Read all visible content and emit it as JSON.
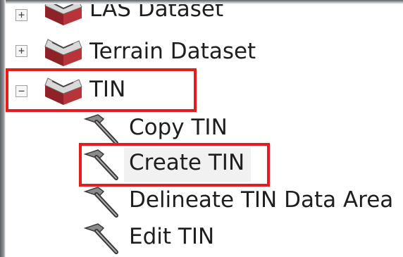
{
  "tree": {
    "toolsets": [
      {
        "label": "LAS Dataset",
        "expander": "+",
        "icon": "toolbox-icon"
      },
      {
        "label": "Terrain Dataset",
        "expander": "+",
        "icon": "toolbox-icon"
      },
      {
        "label": "TIN",
        "expander": "−",
        "icon": "toolbox-icon"
      }
    ],
    "tools": [
      {
        "label": "Copy TIN",
        "icon": "hammer-icon"
      },
      {
        "label": "Create TIN",
        "icon": "hammer-icon"
      },
      {
        "label": "Delineate TIN Data Area",
        "icon": "hammer-icon"
      },
      {
        "label": "Edit TIN",
        "icon": "hammer-icon"
      }
    ]
  },
  "colors": {
    "highlight_border": "#e81b1b",
    "toolbox_red": "#b8343a",
    "background": "#ffffff"
  }
}
